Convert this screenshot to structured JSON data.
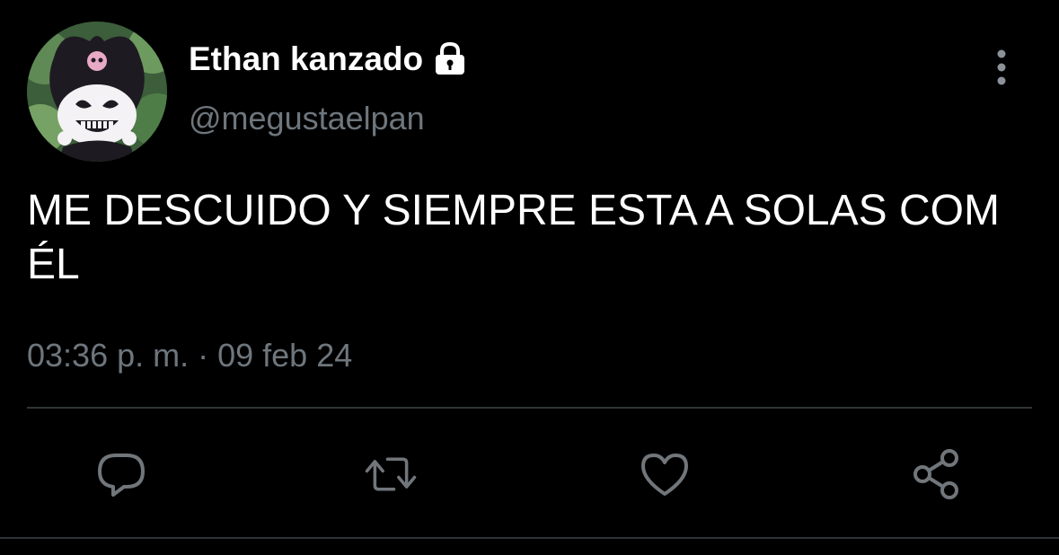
{
  "user": {
    "display_name": "Ethan kanzado",
    "handle": "@megustaelpan",
    "protected_icon": "lock-icon",
    "avatar_icon": "kuromi-avatar"
  },
  "tweet": {
    "text": "ME DESCUIDO Y SIEMPRE ESTA A SOLAS COM ÉL",
    "timestamp": "03:36 p. m. · 09 feb 24"
  },
  "actions": {
    "reply_icon": "reply-icon",
    "retweet_icon": "retweet-icon",
    "like_icon": "heart-icon",
    "share_icon": "share-icon"
  },
  "colors": {
    "background": "#000000",
    "primary_text": "#ffffff",
    "secondary_text": "#6e767d",
    "action_icon": "#71767b",
    "divider": "#2f3336"
  }
}
